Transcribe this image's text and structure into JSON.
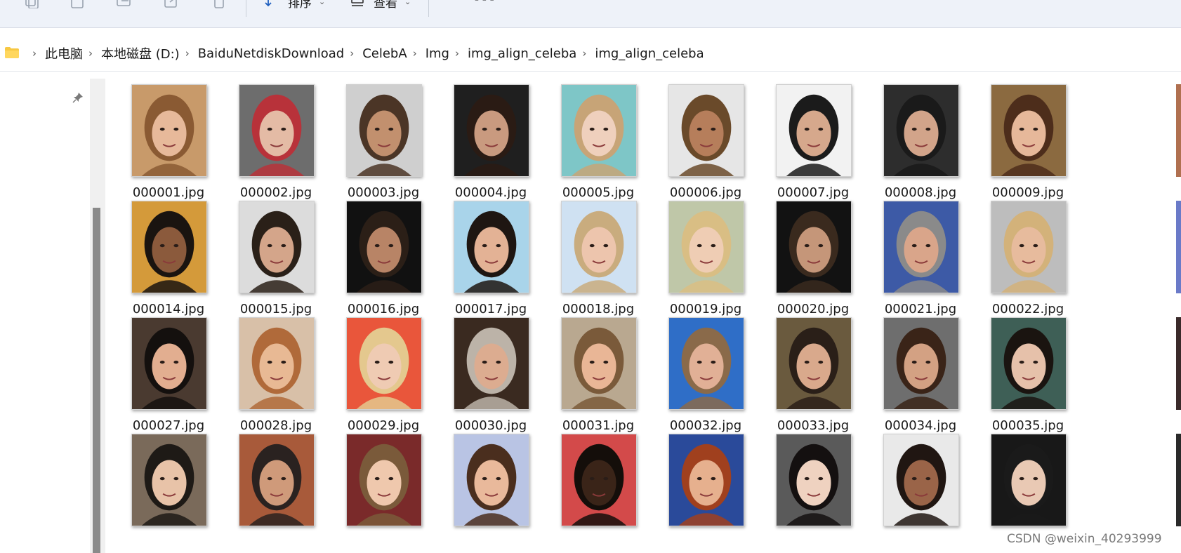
{
  "toolbar": {
    "sort_label": "排序",
    "view_label": "查看",
    "more_label": "···"
  },
  "address": {
    "crumbs": [
      "此电脑",
      "本地磁盘 (D:)",
      "BaiduNetdiskDownload",
      "CelebA",
      "Img",
      "img_align_celeba",
      "img_align_celeba"
    ]
  },
  "files": [
    {
      "name": "000001.jpg",
      "bg": "#c89a6a",
      "face": "#e7b99a",
      "hair": "#8a5a33"
    },
    {
      "name": "000002.jpg",
      "bg": "#6d6d6d",
      "face": "#e4bba5",
      "hair": "#b8323a"
    },
    {
      "name": "000003.jpg",
      "bg": "#cfcfcf",
      "face": "#c2906e",
      "hair": "#4b3526"
    },
    {
      "name": "000004.jpg",
      "bg": "#1f1f1f",
      "face": "#c99a7f",
      "hair": "#2a1b14"
    },
    {
      "name": "000005.jpg",
      "bg": "#7ec6c7",
      "face": "#efd0bd",
      "hair": "#c7a477"
    },
    {
      "name": "000006.jpg",
      "bg": "#e6e6e6",
      "face": "#b67e5b",
      "hair": "#6a4a2a"
    },
    {
      "name": "000007.jpg",
      "bg": "#f2f2f2",
      "face": "#d6a88c",
      "hair": "#1b1b1b"
    },
    {
      "name": "000008.jpg",
      "bg": "#2d2d2d",
      "face": "#d2a48a",
      "hair": "#1a1a1a"
    },
    {
      "name": "000009.jpg",
      "bg": "#8b6a40",
      "face": "#e6b89a",
      "hair": "#4d2d1b"
    },
    {
      "name": "000014.jpg",
      "bg": "#d49a3a",
      "face": "#8b5a3c",
      "hair": "#1a1410"
    },
    {
      "name": "000015.jpg",
      "bg": "#dcdcdc",
      "face": "#d4a58a",
      "hair": "#2a2018"
    },
    {
      "name": "000016.jpg",
      "bg": "#111111",
      "face": "#b88466",
      "hair": "#2b1f17"
    },
    {
      "name": "000017.jpg",
      "bg": "#a9d4ea",
      "face": "#e3b295",
      "hair": "#1e1612"
    },
    {
      "name": "000018.jpg",
      "bg": "#cfe1f2",
      "face": "#edc5ad",
      "hair": "#c9ac7e"
    },
    {
      "name": "000019.jpg",
      "bg": "#bfc7a8",
      "face": "#efcdb4",
      "hair": "#d9be84"
    },
    {
      "name": "000020.jpg",
      "bg": "#121212",
      "face": "#c59679",
      "hair": "#3a2a1e"
    },
    {
      "name": "000021.jpg",
      "bg": "#3d5aa6",
      "face": "#d9a58a",
      "hair": "#8a8a8a"
    },
    {
      "name": "000022.jpg",
      "bg": "#bdbdbd",
      "face": "#e7bb9d",
      "hair": "#d3b27a"
    },
    {
      "name": "000027.jpg",
      "bg": "#4a3a30",
      "face": "#e2ae90",
      "hair": "#14100e"
    },
    {
      "name": "000028.jpg",
      "bg": "#d8c0a8",
      "face": "#e8b994",
      "hair": "#b06a3a"
    },
    {
      "name": "000029.jpg",
      "bg": "#e9563b",
      "face": "#efcbb3",
      "hair": "#e4c88e"
    },
    {
      "name": "000030.jpg",
      "bg": "#3a2a20",
      "face": "#dcac90",
      "hair": "#bcb3a8"
    },
    {
      "name": "000031.jpg",
      "bg": "#b9a890",
      "face": "#e9b696",
      "hair": "#7a5a3a"
    },
    {
      "name": "000032.jpg",
      "bg": "#2f6ec7",
      "face": "#e1b096",
      "hair": "#8a6a4a"
    },
    {
      "name": "000033.jpg",
      "bg": "#6a5a3e",
      "face": "#d9a98c",
      "hair": "#2a1f18"
    },
    {
      "name": "000034.jpg",
      "bg": "#6e6e6e",
      "face": "#d3a183",
      "hair": "#3a2418"
    },
    {
      "name": "000035.jpg",
      "bg": "#3e5f56",
      "face": "#e6c1aa",
      "hair": "#1a1410"
    },
    {
      "name": "",
      "bg": "#7a6a5a",
      "face": "#e8c3a8",
      "hair": "#1e1a16"
    },
    {
      "name": "",
      "bg": "#a85a3a",
      "face": "#cf9a7a",
      "hair": "#2a2220"
    },
    {
      "name": "",
      "bg": "#7a2a2a",
      "face": "#efc8ad",
      "hair": "#7a5a3a"
    },
    {
      "name": "",
      "bg": "#b9c4e4",
      "face": "#e9b99b",
      "hair": "#4a2e1e"
    },
    {
      "name": "",
      "bg": "#d34a4a",
      "face": "#3a2418",
      "hair": "#140e0a"
    },
    {
      "name": "",
      "bg": "#2a4a9a",
      "face": "#e6b08e",
      "hair": "#a0401e"
    },
    {
      "name": "",
      "bg": "#5a5a5a",
      "face": "#efd2c0",
      "hair": "#141010"
    },
    {
      "name": "",
      "bg": "#e9e9e9",
      "face": "#9a6448",
      "hair": "#201612"
    },
    {
      "name": "",
      "bg": "#181818",
      "face": "#e9c9b4",
      "hair": "#1a1a1a"
    }
  ],
  "watermark": "CSDN @weixin_40293999"
}
